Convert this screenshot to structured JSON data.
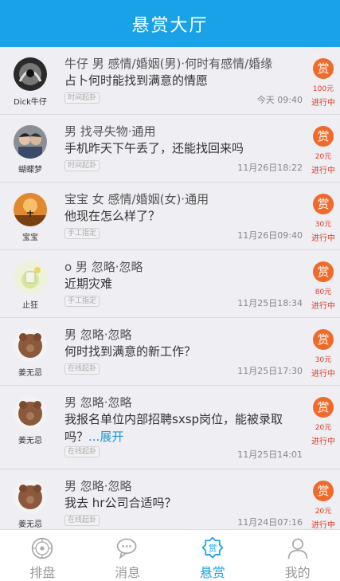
{
  "header": {
    "title": "悬赏大厅"
  },
  "reward_icon_char": "赏",
  "items": [
    {
      "user": "Dick牛仔",
      "line1": "牛仔 男 感情/婚姻(男)·何时有感情/婚缘",
      "line2": "占卜何时能找到满意的情愿",
      "more": "",
      "tag": "时间起卦",
      "time": "今天 09:40",
      "amount": "100元",
      "status": "进行中"
    },
    {
      "user": "蝴蝶梦",
      "line1": "男 找寻失物·通用",
      "line2": "手机昨天下午丢了，还能找回来吗",
      "more": "",
      "tag": "时间起卦",
      "time": "11月26日18:22",
      "amount": "20元",
      "status": "进行中"
    },
    {
      "user": "宝宝",
      "line1": "宝宝 女 感情/婚姻(女)·通用",
      "line2": "他现在怎么样了？",
      "more": "",
      "tag": "手工指定",
      "time": "11月26日09:40",
      "amount": "30元",
      "status": "进行中"
    },
    {
      "user": "止狂",
      "line1": "o 男 忽略·忽略",
      "line2": "近期灾难",
      "more": "",
      "tag": "手工指定",
      "time": "11月25日18:34",
      "amount": "80元",
      "status": "进行中"
    },
    {
      "user": "姜无忌",
      "line1": "男 忽略·忽略",
      "line2": "何时找到满意的新工作？",
      "more": "",
      "tag": "在线起卦",
      "time": "11月25日17:30",
      "amount": "30元",
      "status": "进行中"
    },
    {
      "user": "姜无忌",
      "line1": "男 忽略·忽略",
      "line2": "我报名单位内部招聘sxsp岗位，能被录取吗？",
      "more": "...展开",
      "tag": "在线起卦",
      "time": "11月25日14:01",
      "amount": "20元",
      "status": "进行中"
    },
    {
      "user": "姜无忌",
      "line1": "男 忽略·忽略",
      "line2": "我去 hr公司合适吗？",
      "more": "",
      "tag": "在线起卦",
      "time": "11月24日07:16",
      "amount": "20元",
      "status": "进行中"
    }
  ],
  "tabs": [
    {
      "label": "排盘",
      "icon": "compass-icon",
      "active": false
    },
    {
      "label": "消息",
      "icon": "chat-bubbles-icon",
      "active": false
    },
    {
      "label": "悬赏",
      "icon": "reward-badge-icon",
      "active": true
    },
    {
      "label": "我的",
      "icon": "person-icon",
      "active": false
    }
  ],
  "colors": {
    "primary": "#1aa2e8",
    "reward": "#f06a2a",
    "status": "#e23c25"
  }
}
